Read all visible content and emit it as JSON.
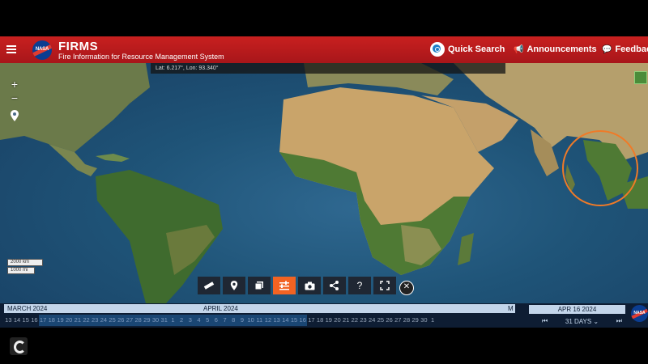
{
  "header": {
    "title": "FIRMS",
    "subtitle": "Fire Information for Resource Management System",
    "logo_text": "NASA",
    "quick_search": "Quick Search",
    "announcements": "Announcements",
    "feedback": "Feedback"
  },
  "map": {
    "coords": "Lat: 6.217°, Lon: 93.340°",
    "zoom_in": "+",
    "zoom_out": "−",
    "scale_km": "2000 km",
    "scale_mi": "1000 mi"
  },
  "toolbar": {
    "items": [
      "ruler-icon",
      "location-pin-icon",
      "layers-icon",
      "settings-sliders-icon",
      "camera-icon",
      "share-icon",
      "help-icon",
      "fullscreen-icon",
      "close-icon"
    ],
    "help_label": "?",
    "close_label": "✕"
  },
  "timeline": {
    "month_march": "MARCH 2024",
    "month_april": "APRIL 2024",
    "month_m": "M",
    "march_days": [
      "13",
      "14",
      "15",
      "16",
      "17",
      "18",
      "19",
      "20",
      "21",
      "22",
      "23",
      "24",
      "25",
      "26",
      "27",
      "28",
      "29",
      "30",
      "31"
    ],
    "april_days": [
      "1",
      "2",
      "3",
      "4",
      "5",
      "6",
      "7",
      "8",
      "9",
      "10",
      "11",
      "12",
      "13",
      "14",
      "15",
      "16",
      "17",
      "18",
      "19",
      "20",
      "21",
      "22",
      "23",
      "24",
      "25",
      "26",
      "27",
      "28",
      "29",
      "30"
    ],
    "after_days": [
      "1"
    ],
    "selected_date": "APR 16 2024",
    "range": "31 DAYS"
  },
  "colors": {
    "header_red": "#b81c1e",
    "accent_orange": "#f26322",
    "highlight_orange": "#f07a27",
    "timeline_dark": "#0e1d33"
  }
}
